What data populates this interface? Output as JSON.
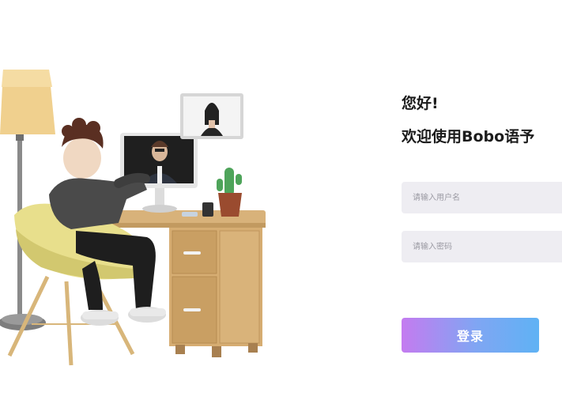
{
  "login": {
    "greeting": "您好!",
    "welcome": "欢迎使用Bobo语予",
    "username_placeholder": "请输入用户名",
    "password_placeholder": "请输入密码",
    "submit_label": "登录"
  },
  "colors": {
    "button_gradient_start": "#c47bf0",
    "button_gradient_end": "#5fb2f4",
    "input_background": "#eeedf2",
    "heading_text": "#1c1c1c"
  }
}
